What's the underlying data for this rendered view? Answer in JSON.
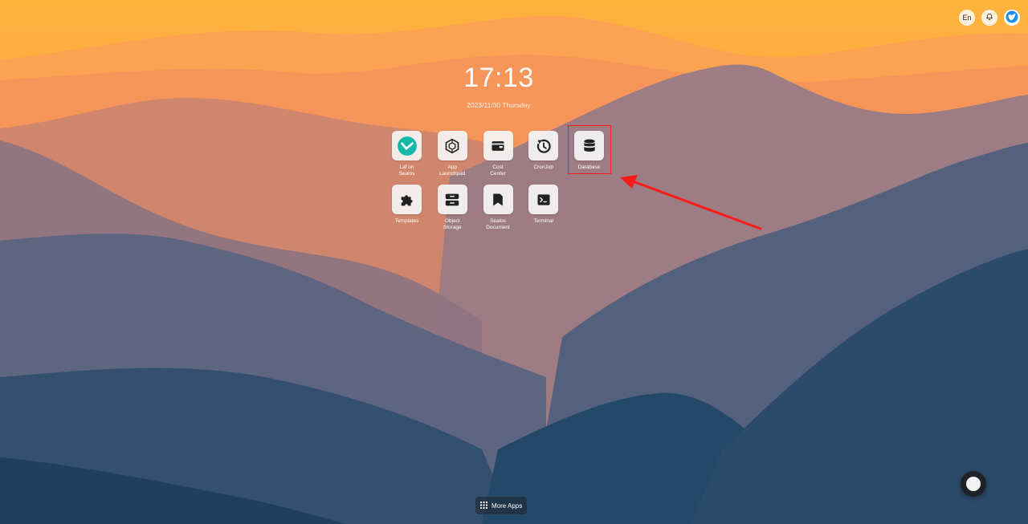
{
  "topbar": {
    "language_label": "En",
    "notification_icon": "bell-icon",
    "logo_icon": "sealos-logo-icon"
  },
  "clock": {
    "time": "17:13",
    "date": "2023/11/30 Thursday"
  },
  "apps": [
    {
      "label": "Laf on\nSealos",
      "icon": "laf-icon"
    },
    {
      "label": "App\nLaunchpad",
      "icon": "launchpad-icon"
    },
    {
      "label": "Cost\nCenter",
      "icon": "wallet-icon"
    },
    {
      "label": "CronJob",
      "icon": "cronjob-icon"
    },
    {
      "label": "Database",
      "icon": "database-icon"
    },
    {
      "label": "Templates",
      "icon": "puzzle-icon"
    },
    {
      "label": "Object\nStorage",
      "icon": "storage-icon"
    },
    {
      "label": "Sealos\nDocument",
      "icon": "document-icon"
    },
    {
      "label": "Terminal",
      "icon": "terminal-icon"
    }
  ],
  "dock": {
    "more_apps_label": "More Apps",
    "more_apps_icon": "grid-icon"
  },
  "annotation": {
    "highlight_color": "#ff1a1a",
    "arrow_color": "#ff1a1a"
  },
  "colors": {
    "sky_top": "#ffb53a",
    "laf_accent": "#14b8a6"
  }
}
